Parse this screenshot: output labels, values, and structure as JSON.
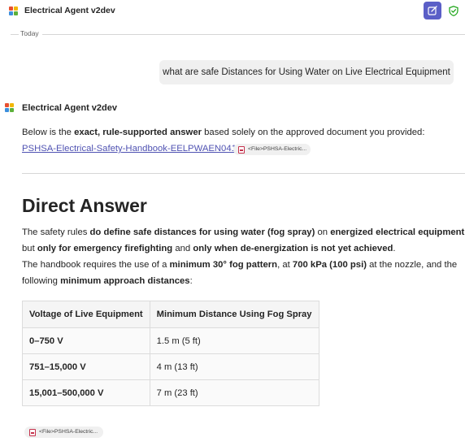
{
  "app": {
    "title": "Electrical Agent v2dev",
    "icons": {
      "app": "app-tile-icon",
      "new_chat": "compose-icon",
      "security": "shield-check-icon"
    },
    "colors": {
      "accent": "#5b5fc7",
      "link": "#4f52b2",
      "security": "#13a10e"
    }
  },
  "conversation": {
    "date_label": "Today",
    "user_message": "what are safe Distances for Using Water on Live Electrical Equipment",
    "bot_name": "Electrical Agent v2dev",
    "intro": {
      "prefix": "Below is the ",
      "bold": "exact, rule-supported answer",
      "suffix": " based solely on the approved document you provided:"
    },
    "document_link": "PSHSA-Electrical-Safety-Handbook-EELPWAEN0413",
    "citation_chip": "<File>PSHSA-Electric..."
  },
  "answer": {
    "heading": "Direct Answer",
    "p1": {
      "a": "The safety rules ",
      "b": "do define safe distances for using water (fog spray)",
      "c": " on ",
      "d": "energized electrical equipment",
      "e": ","
    },
    "p2": {
      "a": "but ",
      "b": "only for emergency firefighting",
      "c": " and ",
      "d": "only when de-energization is not yet achieved",
      "e": "."
    },
    "p3": {
      "a": "The handbook requires the use of a ",
      "b": "minimum 30° fog pattern",
      "c": ", at ",
      "d": "700 kPa (100 psi)",
      "e": " at the nozzle, and the"
    },
    "p4": {
      "a": "following ",
      "b": "minimum approach distances",
      "c": ":"
    },
    "table": {
      "headers": [
        "Voltage of Live Equipment",
        "Minimum Distance Using Fog Spray"
      ],
      "rows": [
        [
          "0–750 V",
          "1.5 m (5 ft)"
        ],
        [
          "751–15,000 V",
          "4 m (13 ft)"
        ],
        [
          "15,001–500,000 V",
          "7 m (23 ft)"
        ]
      ]
    },
    "citation_chip": "<File>PSHSA-Electric..."
  }
}
